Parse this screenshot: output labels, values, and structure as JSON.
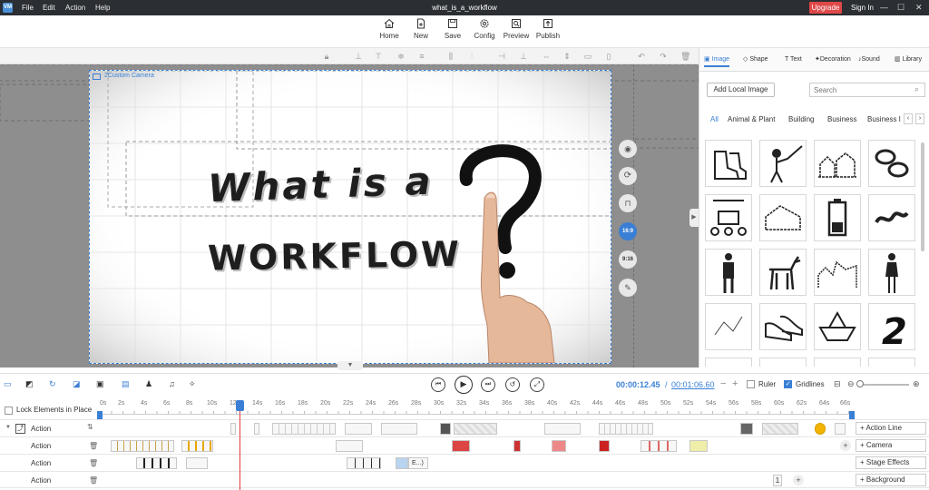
{
  "titlebar": {
    "app_icon": "VM",
    "menus": [
      "File",
      "Edit",
      "Action",
      "Help"
    ],
    "title": "what_is_a_workflow",
    "upgrade": "Upgrade",
    "signin": "Sign In",
    "win_controls": [
      "—",
      "☐",
      "✕"
    ]
  },
  "toolbar": {
    "home": "Home",
    "new": "New",
    "save": "Save",
    "config": "Config",
    "preview": "Preview",
    "publish": "Publish"
  },
  "stage": {
    "camera_label": "2Custom Camera",
    "headline_line1": "What is a",
    "headline_line2": "workflow",
    "side_buttons": [
      "16:9",
      "9:16"
    ]
  },
  "right_panel": {
    "tabs": [
      "Image",
      "Shape",
      "Text",
      "Decoration",
      "Sound",
      "Library"
    ],
    "add_local": "Add Local Image",
    "search_placeholder": "Search",
    "categories": [
      "All",
      "Animal & Plant",
      "Building",
      "Business",
      "Business I"
    ]
  },
  "playbar": {
    "current_time": "00:00:12.45",
    "separator": "/",
    "total_time": "00:01:06.60",
    "ruler": "Ruler",
    "gridlines": "Gridlines"
  },
  "timeline": {
    "lock_label": "Lock Elements in Place",
    "ticks": [
      "0s",
      "2s",
      "4s",
      "6s",
      "8s",
      "10s",
      "12s",
      "14s",
      "16s",
      "18s",
      "20s",
      "22s",
      "24s",
      "26s",
      "28s",
      "30s",
      "32s",
      "34s",
      "36s",
      "38s",
      "40s",
      "42s",
      "44s",
      "46s",
      "48s",
      "50s",
      "52s",
      "54s",
      "56s",
      "58s",
      "60s",
      "62s",
      "64s",
      "66s"
    ],
    "rows": [
      {
        "label": "Action",
        "button": "Action Line"
      },
      {
        "label": "Action",
        "button": "Camera"
      },
      {
        "label": "Action",
        "button": "Stage Effects"
      },
      {
        "label": "Action",
        "button": "Background"
      }
    ],
    "ellipsis_clip": "E...)",
    "bg_clip_number": "1"
  },
  "colors": {
    "accent": "#3a7fd5",
    "upgrade": "#e04848",
    "titlebar": "#2b2e33",
    "playhead": "#e03a3a"
  }
}
